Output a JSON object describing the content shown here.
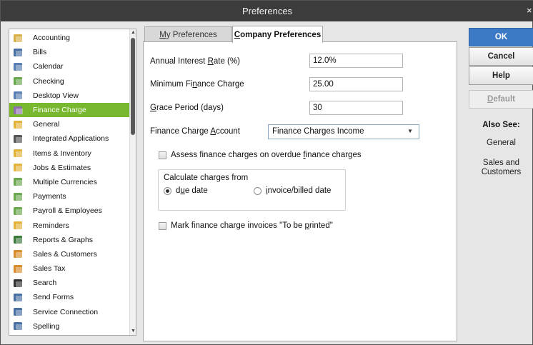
{
  "window": {
    "title": "Preferences",
    "close_glyph": "×"
  },
  "sidebar": {
    "selected_index": 5,
    "items": [
      {
        "label": "Accounting",
        "icon": "pencil-ledger-icon",
        "color": "#d9b14a"
      },
      {
        "label": "Bills",
        "icon": "bill-document-icon",
        "color": "#4a6fa3"
      },
      {
        "label": "Calendar",
        "icon": "calendar-icon",
        "color": "#5b7fb3"
      },
      {
        "label": "Checking",
        "icon": "check-pencil-icon",
        "color": "#6aa84f"
      },
      {
        "label": "Desktop View",
        "icon": "desktop-view-icon",
        "color": "#5b7fb3"
      },
      {
        "label": "Finance Charge",
        "icon": "percent-icon",
        "color": "#8d6fb0"
      },
      {
        "label": "General",
        "icon": "general-folder-icon",
        "color": "#e2b33b"
      },
      {
        "label": "Integrated Applications",
        "icon": "integrated-apps-icon",
        "color": "#555555"
      },
      {
        "label": "Items & Inventory",
        "icon": "inventory-boxes-icon",
        "color": "#e2b33b"
      },
      {
        "label": "Jobs & Estimates",
        "icon": "jobs-estimates-icon",
        "color": "#e2b33b"
      },
      {
        "label": "Multiple Currencies",
        "icon": "currencies-icon",
        "color": "#6aa84f"
      },
      {
        "label": "Payments",
        "icon": "payments-icon",
        "color": "#6aa84f"
      },
      {
        "label": "Payroll & Employees",
        "icon": "payroll-icon",
        "color": "#6aa84f"
      },
      {
        "label": "Reminders",
        "icon": "reminders-hand-icon",
        "color": "#e2b33b"
      },
      {
        "label": "Reports & Graphs",
        "icon": "bar-graph-icon",
        "color": "#3c7a3c"
      },
      {
        "label": "Sales & Customers",
        "icon": "sales-customers-icon",
        "color": "#d98c2b"
      },
      {
        "label": "Sales Tax",
        "icon": "sales-tax-icon",
        "color": "#d98c2b"
      },
      {
        "label": "Search",
        "icon": "search-magnifier-icon",
        "color": "#333333"
      },
      {
        "label": "Send Forms",
        "icon": "send-forms-icon",
        "color": "#4a6fa3"
      },
      {
        "label": "Service Connection",
        "icon": "service-connection-icon",
        "color": "#4a6fa3"
      },
      {
        "label": "Spelling",
        "icon": "spelling-check-icon",
        "color": "#4a6fa3"
      }
    ]
  },
  "tabs": [
    {
      "label_prefix": "",
      "label_underlined": "M",
      "label_rest": "y Preferences",
      "active": false
    },
    {
      "label_prefix": "",
      "label_underlined": "C",
      "label_rest": "ompany Preferences",
      "active": true
    }
  ],
  "form": {
    "interest_rate": {
      "label_pre": "Annual Interest ",
      "label_u": "R",
      "label_post": "ate (%)",
      "value": "12.0%"
    },
    "min_charge": {
      "label_pre": "Minimum Fi",
      "label_u": "n",
      "label_post": "ance Charge",
      "value": "25.00"
    },
    "grace_period": {
      "label_pre": "",
      "label_u": "G",
      "label_post": "race Period (days)",
      "value": "30"
    },
    "account": {
      "label_pre": "Finance Charge ",
      "label_u": "A",
      "label_post": "ccount",
      "value": "Finance Charges Income"
    },
    "assess_overdue": {
      "label_pre": "Assess finance charges on overdue ",
      "label_u": "f",
      "label_post": "inance charges",
      "checked": false
    },
    "calc_group": {
      "title": "Calculate charges from",
      "option_due": {
        "label_pre": "d",
        "label_u": "u",
        "label_post": "e date",
        "selected": true
      },
      "option_invoice": {
        "label_pre": "",
        "label_u": "i",
        "label_post": "nvoice/billed date",
        "selected": false
      }
    },
    "mark_printed": {
      "label_pre": "Mark finance charge invoices \"To be ",
      "label_u": "p",
      "label_post": "rinted\"",
      "checked": false
    }
  },
  "buttons": {
    "ok": "OK",
    "cancel": "Cancel",
    "help": "Help",
    "default_u": "D",
    "default_rest": "efault"
  },
  "also_see": {
    "title": "Also See:",
    "links": [
      "General",
      "Sales and Customers"
    ]
  },
  "colors": {
    "selected": "#77b82e",
    "ok_button": "#3d7ac6",
    "titlebar": "#3c3c3c"
  }
}
